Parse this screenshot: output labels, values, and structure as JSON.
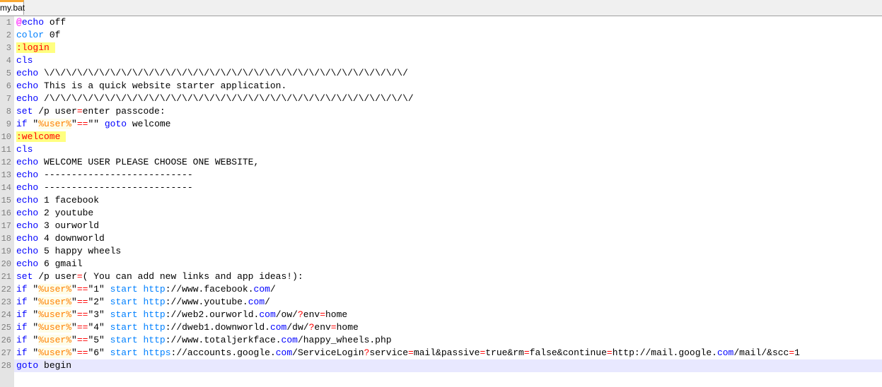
{
  "tab": {
    "label": "my.bat"
  },
  "colors": {
    "keyword": "#0000ff",
    "command": "#0080ff",
    "label": "#ff0000",
    "label_bg": "#ffff80",
    "variable": "#ff8000",
    "operator": "#ff0000",
    "current_line": "#e8e8ff"
  },
  "current_line": 28,
  "lines": [
    [
      [
        "@",
        "a"
      ],
      [
        "echo",
        "k"
      ],
      [
        " off",
        "d"
      ]
    ],
    [
      [
        "color",
        "c"
      ],
      [
        " 0f",
        "d"
      ]
    ],
    [
      [
        ":login ",
        "l"
      ]
    ],
    [
      [
        "cls",
        "k"
      ]
    ],
    [
      [
        "echo",
        "k"
      ],
      [
        " \\/\\/\\/\\/\\/\\/\\/\\/\\/\\/\\/\\/\\/\\/\\/\\/\\/\\/\\/\\/\\/\\/\\/\\/\\/\\/\\/\\/\\/\\/\\/\\/\\/",
        "d"
      ]
    ],
    [
      [
        "echo",
        "k"
      ],
      [
        " This is a quick website starter application.",
        "d"
      ]
    ],
    [
      [
        "echo",
        "k"
      ],
      [
        " /\\/\\/\\/\\/\\/\\/\\/\\/\\/\\/\\/\\/\\/\\/\\/\\/\\/\\/\\/\\/\\/\\/\\/\\/\\/\\/\\/\\/\\/\\/\\/\\/\\/",
        "d"
      ]
    ],
    [
      [
        "set",
        "k"
      ],
      [
        " /p user",
        "d"
      ],
      [
        "=",
        "o"
      ],
      [
        "enter passcode:",
        "d"
      ]
    ],
    [
      [
        "if",
        "k"
      ],
      [
        " \"",
        "d"
      ],
      [
        "%user%",
        "v"
      ],
      [
        "\"",
        "d"
      ],
      [
        "==",
        "o"
      ],
      [
        "\"\" ",
        "d"
      ],
      [
        "goto",
        "k"
      ],
      [
        " welcome",
        "d"
      ]
    ],
    [
      [
        ":welcome ",
        "l"
      ]
    ],
    [
      [
        "cls",
        "k"
      ]
    ],
    [
      [
        "echo",
        "k"
      ],
      [
        " WELCOME USER PLEASE CHOOSE ONE WEBSITE,",
        "d"
      ]
    ],
    [
      [
        "echo",
        "k"
      ],
      [
        " ---------------------------",
        "d"
      ]
    ],
    [
      [
        "echo",
        "k"
      ],
      [
        " ---------------------------",
        "d"
      ]
    ],
    [
      [
        "echo",
        "k"
      ],
      [
        " 1 facebook",
        "d"
      ]
    ],
    [
      [
        "echo",
        "k"
      ],
      [
        " 2 youtube",
        "d"
      ]
    ],
    [
      [
        "echo",
        "k"
      ],
      [
        " 3 ourworld",
        "d"
      ]
    ],
    [
      [
        "echo",
        "k"
      ],
      [
        " 4 downworld",
        "d"
      ]
    ],
    [
      [
        "echo",
        "k"
      ],
      [
        " 5 happy wheels",
        "d"
      ]
    ],
    [
      [
        "echo",
        "k"
      ],
      [
        " 6 gmail",
        "d"
      ]
    ],
    [
      [
        "set",
        "k"
      ],
      [
        " /p user",
        "d"
      ],
      [
        "=",
        "o"
      ],
      [
        "( You can add new links and app ideas!):",
        "d"
      ]
    ],
    [
      [
        "if",
        "k"
      ],
      [
        " \"",
        "d"
      ],
      [
        "%user%",
        "v"
      ],
      [
        "\"",
        "d"
      ],
      [
        "==",
        "o"
      ],
      [
        "\"1\" ",
        "d"
      ],
      [
        "start",
        "c"
      ],
      [
        " ",
        "d"
      ],
      [
        "http",
        "c"
      ],
      [
        "://www.facebook.",
        "d"
      ],
      [
        "com",
        "m"
      ],
      [
        "/",
        "d"
      ]
    ],
    [
      [
        "if",
        "k"
      ],
      [
        " \"",
        "d"
      ],
      [
        "%user%",
        "v"
      ],
      [
        "\"",
        "d"
      ],
      [
        "==",
        "o"
      ],
      [
        "\"2\" ",
        "d"
      ],
      [
        "start",
        "c"
      ],
      [
        " ",
        "d"
      ],
      [
        "http",
        "c"
      ],
      [
        "://www.youtube.",
        "d"
      ],
      [
        "com",
        "m"
      ],
      [
        "/",
        "d"
      ]
    ],
    [
      [
        "if",
        "k"
      ],
      [
        " \"",
        "d"
      ],
      [
        "%user%",
        "v"
      ],
      [
        "\"",
        "d"
      ],
      [
        "==",
        "o"
      ],
      [
        "\"3\" ",
        "d"
      ],
      [
        "start",
        "c"
      ],
      [
        " ",
        "d"
      ],
      [
        "http",
        "c"
      ],
      [
        "://web2.ourworld.",
        "d"
      ],
      [
        "com",
        "m"
      ],
      [
        "/ow/",
        "d"
      ],
      [
        "?",
        "o"
      ],
      [
        "env",
        "d"
      ],
      [
        "=",
        "o"
      ],
      [
        "home",
        "d"
      ]
    ],
    [
      [
        "if",
        "k"
      ],
      [
        " \"",
        "d"
      ],
      [
        "%user%",
        "v"
      ],
      [
        "\"",
        "d"
      ],
      [
        "==",
        "o"
      ],
      [
        "\"4\" ",
        "d"
      ],
      [
        "start",
        "c"
      ],
      [
        " ",
        "d"
      ],
      [
        "http",
        "c"
      ],
      [
        "://dweb1.downworld.",
        "d"
      ],
      [
        "com",
        "m"
      ],
      [
        "/dw/",
        "d"
      ],
      [
        "?",
        "o"
      ],
      [
        "env",
        "d"
      ],
      [
        "=",
        "o"
      ],
      [
        "home",
        "d"
      ]
    ],
    [
      [
        "if",
        "k"
      ],
      [
        " \"",
        "d"
      ],
      [
        "%user%",
        "v"
      ],
      [
        "\"",
        "d"
      ],
      [
        "==",
        "o"
      ],
      [
        "\"5\" ",
        "d"
      ],
      [
        "start",
        "c"
      ],
      [
        " ",
        "d"
      ],
      [
        "http",
        "c"
      ],
      [
        "://www.totaljerkface.",
        "d"
      ],
      [
        "com",
        "m"
      ],
      [
        "/happy_wheels.php",
        "d"
      ]
    ],
    [
      [
        "if",
        "k"
      ],
      [
        " \"",
        "d"
      ],
      [
        "%user%",
        "v"
      ],
      [
        "\"",
        "d"
      ],
      [
        "==",
        "o"
      ],
      [
        "\"6\" ",
        "d"
      ],
      [
        "start",
        "c"
      ],
      [
        " ",
        "d"
      ],
      [
        "https",
        "c"
      ],
      [
        "://accounts.google.",
        "d"
      ],
      [
        "com",
        "m"
      ],
      [
        "/ServiceLogin",
        "d"
      ],
      [
        "?",
        "o"
      ],
      [
        "service",
        "d"
      ],
      [
        "=",
        "o"
      ],
      [
        "mail&passive",
        "d"
      ],
      [
        "=",
        "o"
      ],
      [
        "true&rm",
        "d"
      ],
      [
        "=",
        "o"
      ],
      [
        "false&continue",
        "d"
      ],
      [
        "=",
        "o"
      ],
      [
        "http://mail.google.",
        "d"
      ],
      [
        "com",
        "m"
      ],
      [
        "/mail/&scc",
        "d"
      ],
      [
        "=",
        "o"
      ],
      [
        "1",
        "d"
      ]
    ],
    [
      [
        "goto",
        "k"
      ],
      [
        " begin",
        "d"
      ]
    ]
  ]
}
